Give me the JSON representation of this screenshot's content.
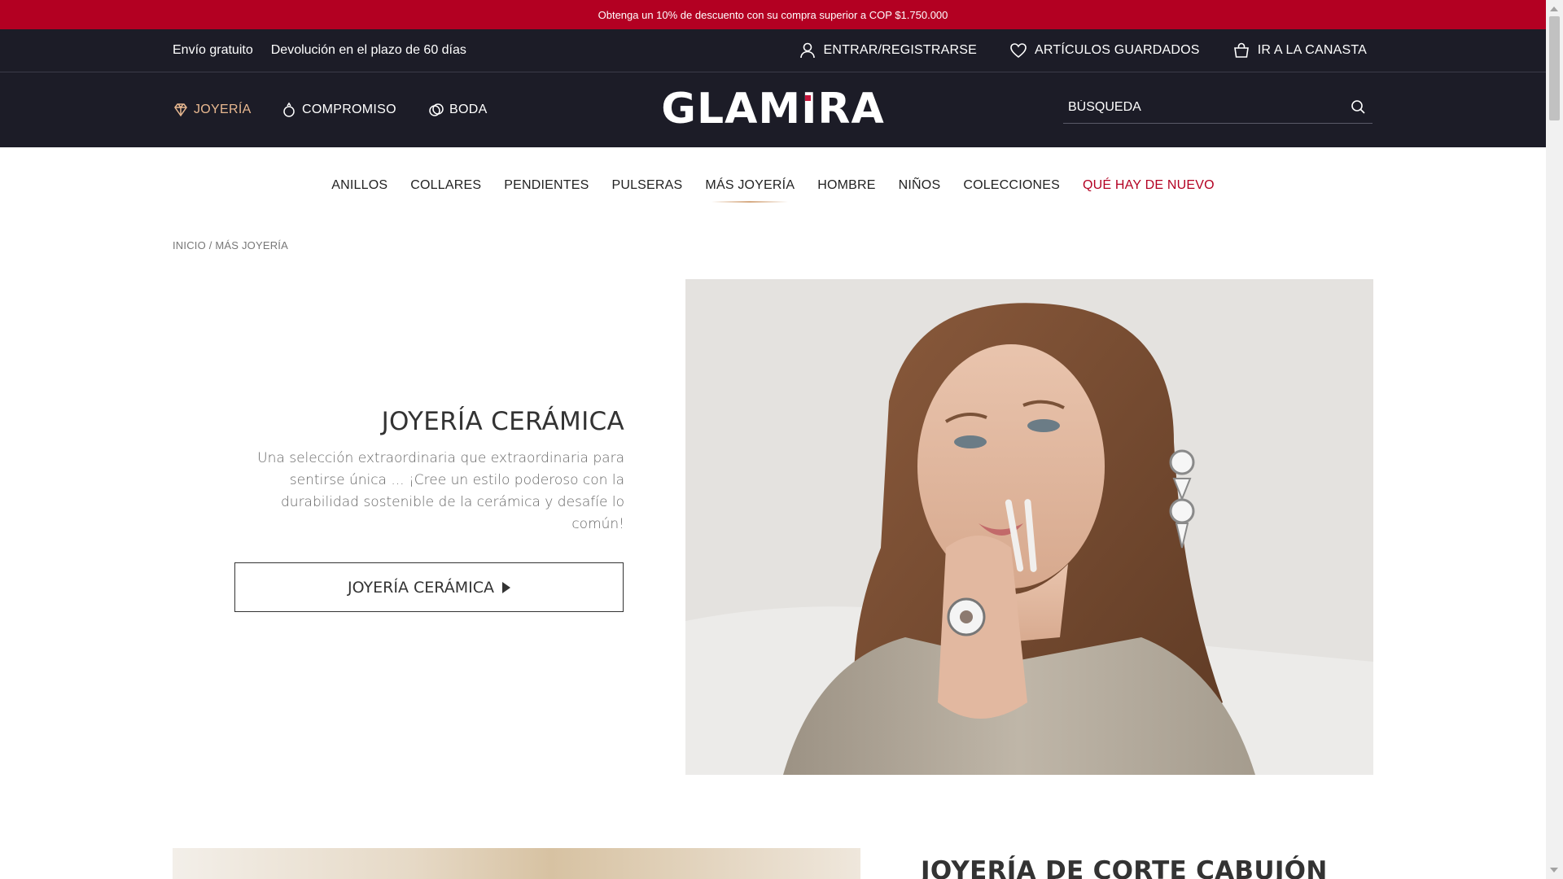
{
  "promo": {
    "text": "Obtenga un 10% de descuento con su compra superior a COP $1.750.000"
  },
  "utility": {
    "shipping": "Envío gratuito",
    "returns": "Devolución en el plazo de 60 días",
    "login": {
      "label": "ENTRAR/REGISTRARSE",
      "icon": "user-icon"
    },
    "saved": {
      "label": "ARTÍCULOS GUARDADOS",
      "icon": "heart-icon"
    },
    "cart": {
      "label": "IR A LA CANASTA",
      "icon": "cart-icon"
    }
  },
  "header": {
    "logo": "GLAMIRA",
    "categories": [
      {
        "label": "JOYERÍA",
        "icon": "diamond-icon",
        "active": true
      },
      {
        "label": "COMPROMISO",
        "icon": "ring-icon",
        "active": false
      },
      {
        "label": "BODA",
        "icon": "wedding-rings-icon",
        "active": false
      }
    ],
    "search": {
      "placeholder": "BÚSQUEDA",
      "icon": "search-icon"
    }
  },
  "subnav": {
    "items": [
      "ANILLOS",
      "COLLARES",
      "PENDIENTES",
      "PULSERAS",
      "MÁS JOYERÍA",
      "HOMBRE",
      "NIÑOS",
      "COLECCIONES",
      "QUÉ HAY DE NUEVO"
    ],
    "current": "MÁS JOYERÍA",
    "highlight": "QUÉ HAY DE NUEVO"
  },
  "breadcrumb": {
    "home": "INICIO",
    "separator": " / ",
    "current": "MÁS JOYERÍA"
  },
  "hero": {
    "title": "JOYERÍA CERÁMICA",
    "description": "Una selección extraordinaria que extraordinaria para sentirse única ... ¡Cree un estilo poderoso con la durabilidad sostenible de la cerámica y desafíe lo común!",
    "button_label": "JOYERÍA CERÁMICA"
  },
  "section2": {
    "title": "JOYERÍA DE CORTE CABUJÓN"
  },
  "colors": {
    "promo_bg": "#b30022",
    "header_bg": "#1c1c27",
    "accent_gold": "#e8b890",
    "highlight_red": "#b30022"
  }
}
